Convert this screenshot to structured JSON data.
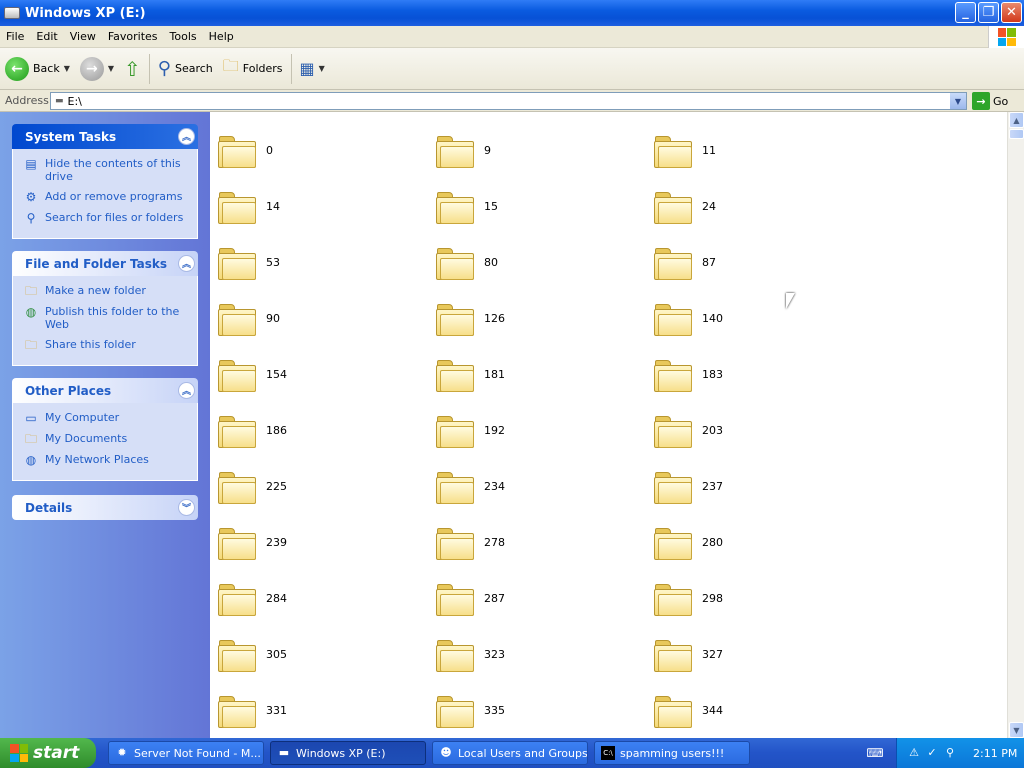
{
  "window": {
    "title": "Windows XP (E:)"
  },
  "menu": [
    "File",
    "Edit",
    "View",
    "Favorites",
    "Tools",
    "Help"
  ],
  "toolbar": {
    "back": "Back",
    "search": "Search",
    "folders": "Folders"
  },
  "address": {
    "label": "Address",
    "value": "E:\\",
    "go": "Go"
  },
  "panels": {
    "system_tasks": {
      "title": "System Tasks",
      "items": [
        "Hide the contents of this drive",
        "Add or remove programs",
        "Search for files or folders"
      ]
    },
    "file_folder_tasks": {
      "title": "File and Folder Tasks",
      "items": [
        "Make a new folder",
        "Publish this folder to the Web",
        "Share this folder"
      ]
    },
    "other_places": {
      "title": "Other Places",
      "items": [
        "My Computer",
        "My Documents",
        "My Network Places"
      ]
    },
    "details": {
      "title": "Details"
    }
  },
  "folders": [
    "0",
    "9",
    "11",
    "14",
    "15",
    "24",
    "53",
    "80",
    "87",
    "90",
    "126",
    "140",
    "154",
    "181",
    "183",
    "186",
    "192",
    "203",
    "225",
    "234",
    "237",
    "239",
    "278",
    "280",
    "284",
    "287",
    "298",
    "305",
    "323",
    "327",
    "331",
    "335",
    "344"
  ],
  "taskbar": {
    "start": "start",
    "tasks": [
      "Server Not Found - M...",
      "Windows XP (E:)",
      "Local Users and Groups",
      "spamming users!!!"
    ],
    "clock": "2:11 PM"
  }
}
